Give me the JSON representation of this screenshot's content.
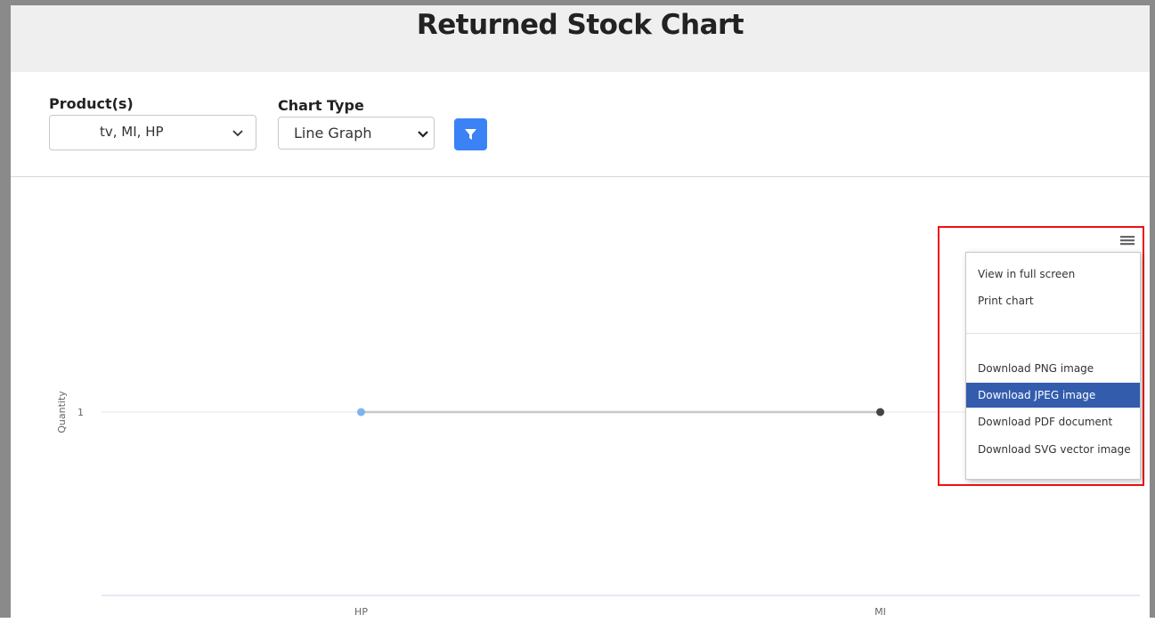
{
  "title": "Returned Stock Chart",
  "filters": {
    "products_label": "Product(s)",
    "products_value": "tv, MI, HP",
    "chart_type_label": "Chart Type",
    "chart_type_value": "Line Graph",
    "filter_icon": "filter-icon"
  },
  "export_menu": {
    "button_icon": "hamburger-menu-icon",
    "items": [
      "View in full screen",
      "Print chart",
      "Download PNG image",
      "Download JPEG image",
      "Download PDF document",
      "Download SVG vector image"
    ],
    "active_item": "Download JPEG image"
  },
  "colors": {
    "accent": "#3b82f6",
    "menu_active": "#335cad",
    "highlight_box": "#e11111",
    "point_hp": "#7cb5ec",
    "point_mi": "#434348"
  },
  "chart_data": {
    "type": "line",
    "categories": [
      "HP",
      "MI"
    ],
    "series": [
      {
        "values": [
          1,
          1
        ]
      }
    ],
    "ylabel": "Quantity",
    "y_ticks": [
      "1"
    ],
    "point_colors": [
      "#7cb5ec",
      "#434348"
    ]
  }
}
